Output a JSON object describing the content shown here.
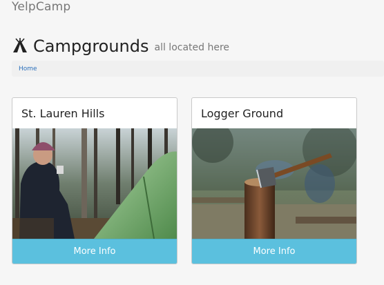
{
  "navbar": {
    "brand": "YelpCamp"
  },
  "header": {
    "icon": "tent-icon",
    "title": "Campgrounds",
    "subtitle": "all located here"
  },
  "breadcrumb": {
    "home": "Home"
  },
  "campgrounds": [
    {
      "name": "St. Lauren Hills",
      "image": "camper-with-tent-photo",
      "button": "More Info"
    },
    {
      "name": "Logger Ground",
      "image": "axe-in-stump-photo",
      "button": "More Info"
    }
  ],
  "colors": {
    "button": "#5bc0de",
    "link": "#2a6fbb",
    "brand": "#777777"
  }
}
